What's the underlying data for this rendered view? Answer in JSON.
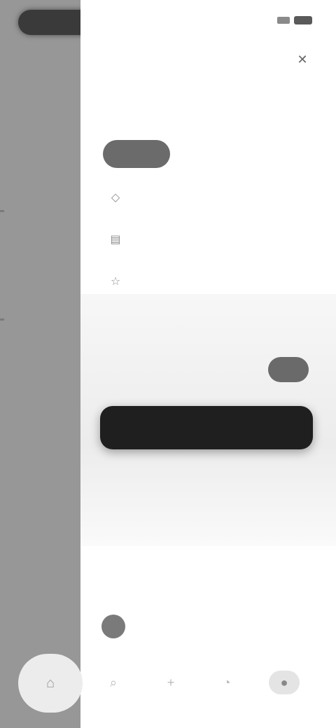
{
  "status_bar": {
    "time": "",
    "icons": [
      "signal-icon",
      "battery-icon"
    ]
  },
  "drawer": {
    "title": "",
    "close_icon": "close-icon"
  },
  "nav": {
    "active_label": "",
    "items": [
      {
        "icon": "tag-icon",
        "label": ""
      },
      {
        "icon": "document-icon",
        "label": ""
      },
      {
        "icon": "star-icon",
        "label": ""
      }
    ]
  },
  "promo": {
    "title": "",
    "subtitle": "",
    "toggle_on": true,
    "button_label": ""
  },
  "account": {
    "line1": "",
    "line2": "",
    "line3": ""
  },
  "section": {
    "label": "",
    "profile_name": ""
  },
  "tabbar": {
    "items": [
      "home-icon",
      "search-icon",
      "plus-icon",
      "bell-icon",
      "profile-icon"
    ]
  },
  "colors": {
    "accent": "#1f1f1f",
    "backdrop": "#979797",
    "panel": "#ffffff"
  }
}
